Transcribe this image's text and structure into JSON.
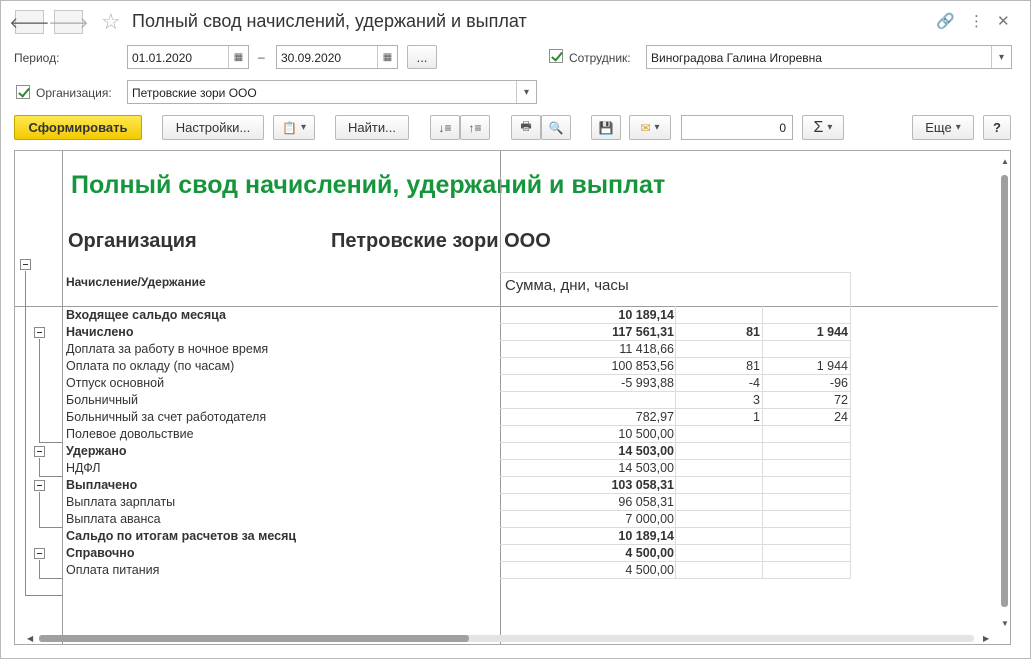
{
  "window": {
    "title": "Полный свод начислений, удержаний и выплат",
    "icons": [
      "back-arrow-icon",
      "forward-arrow-icon",
      "star-icon",
      "link-icon",
      "more-vertical-icon",
      "close-icon"
    ]
  },
  "filters": {
    "period_label": "Период:",
    "date_from": "01.01.2020",
    "date_dash": "–",
    "date_to": "30.09.2020",
    "period_more": "...",
    "employee_label": "Сотрудник:",
    "employee_checked": true,
    "employee_value": "Виноградова Галина Игоревна",
    "org_label": "Организация:",
    "org_checked": true,
    "org_value": "Петровские зори ООО"
  },
  "toolbar": {
    "generate": "Сформировать",
    "settings": "Настройки...",
    "find": "Найти...",
    "sum_value": "0",
    "sum_symbol": "Σ",
    "more": "Еще",
    "help": "?"
  },
  "report": {
    "title": "Полный свод начислений, удержаний и выплат",
    "org_label": "Организация",
    "org_value": "Петровские зори ООО",
    "col_header_1": "Начисление/Удержание",
    "col_header_2": "Сумма, дни, часы",
    "rows": [
      {
        "name": "Входящее сальдо месяца",
        "sum": "10 189,14",
        "days": "",
        "hours": "",
        "bold": true
      },
      {
        "name": "Начислено",
        "sum": "117 561,31",
        "days": "81",
        "hours": "1 944",
        "bold": true
      },
      {
        "name": "Доплата за работу в ночное время",
        "sum": "11 418,66",
        "days": "",
        "hours": "",
        "bold": false
      },
      {
        "name": "Оплата по окладу (по часам)",
        "sum": "100 853,56",
        "days": "81",
        "hours": "1 944",
        "bold": false
      },
      {
        "name": "Отпуск основной",
        "sum": "-5 993,88",
        "days": "-4",
        "hours": "-96",
        "bold": false
      },
      {
        "name": "Больничный",
        "sum": "",
        "days": "3",
        "hours": "72",
        "bold": false
      },
      {
        "name": "Больничный за счет работодателя",
        "sum": "782,97",
        "days": "1",
        "hours": "24",
        "bold": false
      },
      {
        "name": "Полевое довольствие",
        "sum": "10 500,00",
        "days": "",
        "hours": "",
        "bold": false
      },
      {
        "name": "Удержано",
        "sum": "14 503,00",
        "days": "",
        "hours": "",
        "bold": true
      },
      {
        "name": "НДФЛ",
        "sum": "14 503,00",
        "days": "",
        "hours": "",
        "bold": false
      },
      {
        "name": "Выплачено",
        "sum": "103 058,31",
        "days": "",
        "hours": "",
        "bold": true
      },
      {
        "name": "Выплата зарплаты",
        "sum": "96 058,31",
        "days": "",
        "hours": "",
        "bold": false
      },
      {
        "name": "Выплата аванса",
        "sum": "7 000,00",
        "days": "",
        "hours": "",
        "bold": false
      },
      {
        "name": "Сальдо по итогам расчетов за месяц",
        "sum": "10 189,14",
        "days": "",
        "hours": "",
        "bold": true
      },
      {
        "name": "Справочно",
        "sum": "4 500,00",
        "days": "",
        "hours": "",
        "bold": true
      },
      {
        "name": "Оплата питания",
        "sum": "4 500,00",
        "days": "",
        "hours": "",
        "bold": false
      }
    ]
  },
  "colors": {
    "title_green": "#15963c",
    "primary_button": "#f3c900"
  }
}
